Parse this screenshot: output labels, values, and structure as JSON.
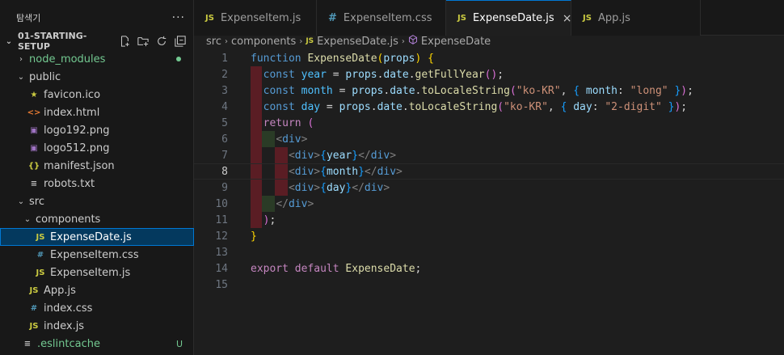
{
  "sidebar": {
    "title": "탐색기",
    "more": "···",
    "project": "01-STARTING-SETUP",
    "items": [
      {
        "label": "node_modules",
        "kind": "folder",
        "depth": 1,
        "chev": "›",
        "green": true,
        "status": "dot"
      },
      {
        "label": "public",
        "kind": "folder",
        "depth": 1,
        "chev": "⌄"
      },
      {
        "label": "favicon.ico",
        "kind": "star",
        "depth": 2
      },
      {
        "label": "index.html",
        "kind": "html",
        "depth": 2
      },
      {
        "label": "logo192.png",
        "kind": "img",
        "depth": 2
      },
      {
        "label": "logo512.png",
        "kind": "img",
        "depth": 2
      },
      {
        "label": "manifest.json",
        "kind": "json",
        "depth": 2
      },
      {
        "label": "robots.txt",
        "kind": "txt",
        "depth": 2
      },
      {
        "label": "src",
        "kind": "folder",
        "depth": 1,
        "chev": "⌄"
      },
      {
        "label": "components",
        "kind": "folder",
        "depth": 2,
        "chev": "⌄"
      },
      {
        "label": "ExpenseDate.js",
        "kind": "js",
        "depth": 3,
        "selected": true
      },
      {
        "label": "ExpenseItem.css",
        "kind": "css",
        "depth": 3
      },
      {
        "label": "ExpenseItem.js",
        "kind": "js",
        "depth": 3
      },
      {
        "label": "App.js",
        "kind": "js",
        "depth": 2
      },
      {
        "label": "index.css",
        "kind": "css",
        "depth": 2
      },
      {
        "label": "index.js",
        "kind": "js",
        "depth": 2
      },
      {
        "label": ".eslintcache",
        "kind": "txt",
        "depth": 1,
        "green": true,
        "status": "U"
      }
    ]
  },
  "tabs": [
    {
      "label": "ExpenseItem.js",
      "icon": "JS",
      "active": false
    },
    {
      "label": "ExpenseItem.css",
      "icon": "#",
      "active": false
    },
    {
      "label": "ExpenseDate.js",
      "icon": "JS",
      "active": true,
      "close": "×"
    },
    {
      "label": "App.js",
      "icon": "JS",
      "active": false
    }
  ],
  "breadcrumb": {
    "parts": [
      "src",
      "components",
      "ExpenseDate.js",
      "ExpenseDate"
    ],
    "file_icon": "JS"
  },
  "code": {
    "current_line": 8,
    "lines": [
      [
        [
          "kw",
          "function "
        ],
        [
          "fn",
          "ExpenseDate"
        ],
        [
          "br1",
          "("
        ],
        [
          "vr",
          "props"
        ],
        [
          "br1",
          ")"
        ],
        [
          "pn",
          " "
        ],
        [
          "br1",
          "{"
        ]
      ],
      [
        [
          "pn",
          "  "
        ],
        [
          "kw",
          "const "
        ],
        [
          "cn",
          "year"
        ],
        [
          "pn",
          " = "
        ],
        [
          "vr",
          "props"
        ],
        [
          "pn",
          "."
        ],
        [
          "vr",
          "date"
        ],
        [
          "pn",
          "."
        ],
        [
          "fn",
          "getFullYear"
        ],
        [
          "br2",
          "()"
        ],
        [
          "pn",
          ";"
        ]
      ],
      [
        [
          "pn",
          "  "
        ],
        [
          "kw",
          "const "
        ],
        [
          "cn",
          "month"
        ],
        [
          "pn",
          " = "
        ],
        [
          "vr",
          "props"
        ],
        [
          "pn",
          "."
        ],
        [
          "vr",
          "date"
        ],
        [
          "pn",
          "."
        ],
        [
          "fn",
          "toLocaleString"
        ],
        [
          "br2",
          "("
        ],
        [
          "st",
          "\"ko-KR\""
        ],
        [
          "pn",
          ", "
        ],
        [
          "br3",
          "{"
        ],
        [
          "pn",
          " "
        ],
        [
          "vr",
          "month"
        ],
        [
          "pn",
          ": "
        ],
        [
          "st",
          "\"long\""
        ],
        [
          "pn",
          " "
        ],
        [
          "br3",
          "}"
        ],
        [
          "br2",
          ")"
        ],
        [
          "pn",
          ";"
        ]
      ],
      [
        [
          "pn",
          "  "
        ],
        [
          "kw",
          "const "
        ],
        [
          "cn",
          "day"
        ],
        [
          "pn",
          " = "
        ],
        [
          "vr",
          "props"
        ],
        [
          "pn",
          "."
        ],
        [
          "vr",
          "date"
        ],
        [
          "pn",
          "."
        ],
        [
          "fn",
          "toLocaleString"
        ],
        [
          "br2",
          "("
        ],
        [
          "st",
          "\"ko-KR\""
        ],
        [
          "pn",
          ", "
        ],
        [
          "br3",
          "{"
        ],
        [
          "pn",
          " "
        ],
        [
          "vr",
          "day"
        ],
        [
          "pn",
          ": "
        ],
        [
          "st",
          "\"2-digit\""
        ],
        [
          "pn",
          " "
        ],
        [
          "br3",
          "}"
        ],
        [
          "br2",
          ")"
        ],
        [
          "pn",
          ";"
        ]
      ],
      [
        [
          "pn",
          "  "
        ],
        [
          "kwc",
          "return "
        ],
        [
          "br2",
          "("
        ]
      ],
      [
        [
          "pn",
          "    "
        ],
        [
          "tagp",
          "<"
        ],
        [
          "tag",
          "div"
        ],
        [
          "tagp",
          ">"
        ]
      ],
      [
        [
          "pn",
          "      "
        ],
        [
          "tagp",
          "<"
        ],
        [
          "tag",
          "div"
        ],
        [
          "tagp",
          ">"
        ],
        [
          "br3",
          "{"
        ],
        [
          "vr",
          "year"
        ],
        [
          "br3",
          "}"
        ],
        [
          "tagp",
          "</"
        ],
        [
          "tag",
          "div"
        ],
        [
          "tagp",
          ">"
        ]
      ],
      [
        [
          "pn",
          "      "
        ],
        [
          "tagp",
          "<"
        ],
        [
          "tag",
          "div"
        ],
        [
          "tagp",
          ">"
        ],
        [
          "br3",
          "{"
        ],
        [
          "vr",
          "month"
        ],
        [
          "br3",
          "}"
        ],
        [
          "tagp",
          "</"
        ],
        [
          "tag",
          "div"
        ],
        [
          "tagp",
          ">"
        ]
      ],
      [
        [
          "pn",
          "      "
        ],
        [
          "tagp",
          "<"
        ],
        [
          "tag",
          "div"
        ],
        [
          "tagp",
          ">"
        ],
        [
          "br3",
          "{"
        ],
        [
          "vr",
          "day"
        ],
        [
          "br3",
          "}"
        ],
        [
          "tagp",
          "</"
        ],
        [
          "tag",
          "div"
        ],
        [
          "tagp",
          ">"
        ]
      ],
      [
        [
          "pn",
          "    "
        ],
        [
          "tagp",
          "</"
        ],
        [
          "tag",
          "div"
        ],
        [
          "tagp",
          ">"
        ]
      ],
      [
        [
          "pn",
          "  "
        ],
        [
          "br2",
          ")"
        ],
        [
          "pn",
          ";"
        ]
      ],
      [
        [
          "br1",
          "}"
        ]
      ],
      [],
      [
        [
          "kwc",
          "export "
        ],
        [
          "kwc",
          "default "
        ],
        [
          "fn",
          "ExpenseDate"
        ],
        [
          "pn",
          ";"
        ]
      ],
      []
    ]
  },
  "colors": {
    "accent": "#0078d4",
    "js_icon": "#cbcb41",
    "css_icon": "#519aba",
    "html_icon": "#e37933",
    "git_untracked": "#73c991"
  }
}
